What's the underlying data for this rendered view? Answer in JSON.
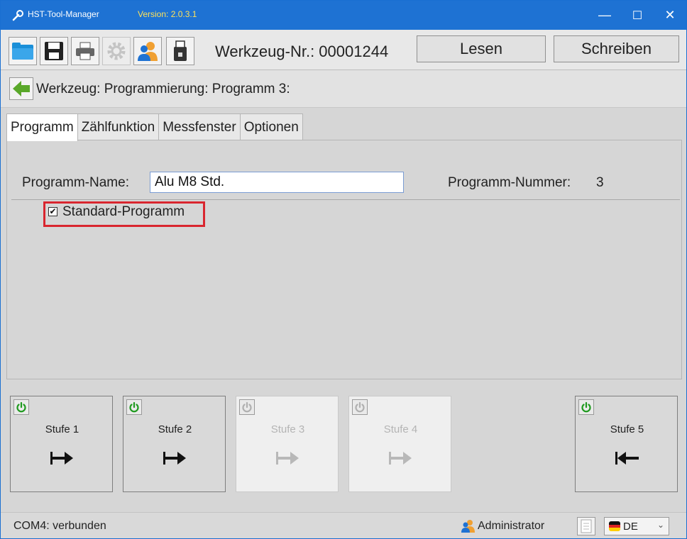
{
  "window": {
    "title": "HST-Tool-Manager",
    "version": "Version: 2.0.3.1",
    "controls": {
      "minimize": "—",
      "maximize": "☐",
      "close": "✕"
    }
  },
  "toolbar": {
    "icons": [
      "folder-icon",
      "save-icon",
      "printer-icon",
      "gear-icon",
      "users-icon",
      "usb-icon"
    ],
    "werkzeug_nr": "Werkzeug-Nr.: 00001244",
    "read_label": "Lesen",
    "write_label": "Schreiben"
  },
  "breadcrumb": {
    "text": "Werkzeug: Programmierung: Programm 3:"
  },
  "tabs": [
    "Programm",
    "Zählfunktion",
    "Messfenster",
    "Optionen"
  ],
  "program": {
    "name_label": "Programm-Name:",
    "name_value": "Alu M8 Std.",
    "number_label": "Programm-Nummer:",
    "number_value": "3",
    "standard_label": "Standard-Programm",
    "standard_checked": true
  },
  "stages": [
    {
      "label": "Stufe 1",
      "active": true,
      "direction": "right"
    },
    {
      "label": "Stufe 2",
      "active": true,
      "direction": "right"
    },
    {
      "label": "Stufe 3",
      "active": false,
      "direction": "right"
    },
    {
      "label": "Stufe 4",
      "active": false,
      "direction": "right"
    },
    {
      "label": "Stufe 5",
      "active": true,
      "direction": "left"
    }
  ],
  "status": {
    "connection": "COM4: verbunden",
    "user": "Administrator",
    "language": "DE"
  },
  "colors": {
    "titlebar": "#1e72d3",
    "version": "#ffe259",
    "highlight": "#d9262f",
    "power_active": "#1f9a1f",
    "power_inactive": "#b0b0b0"
  }
}
